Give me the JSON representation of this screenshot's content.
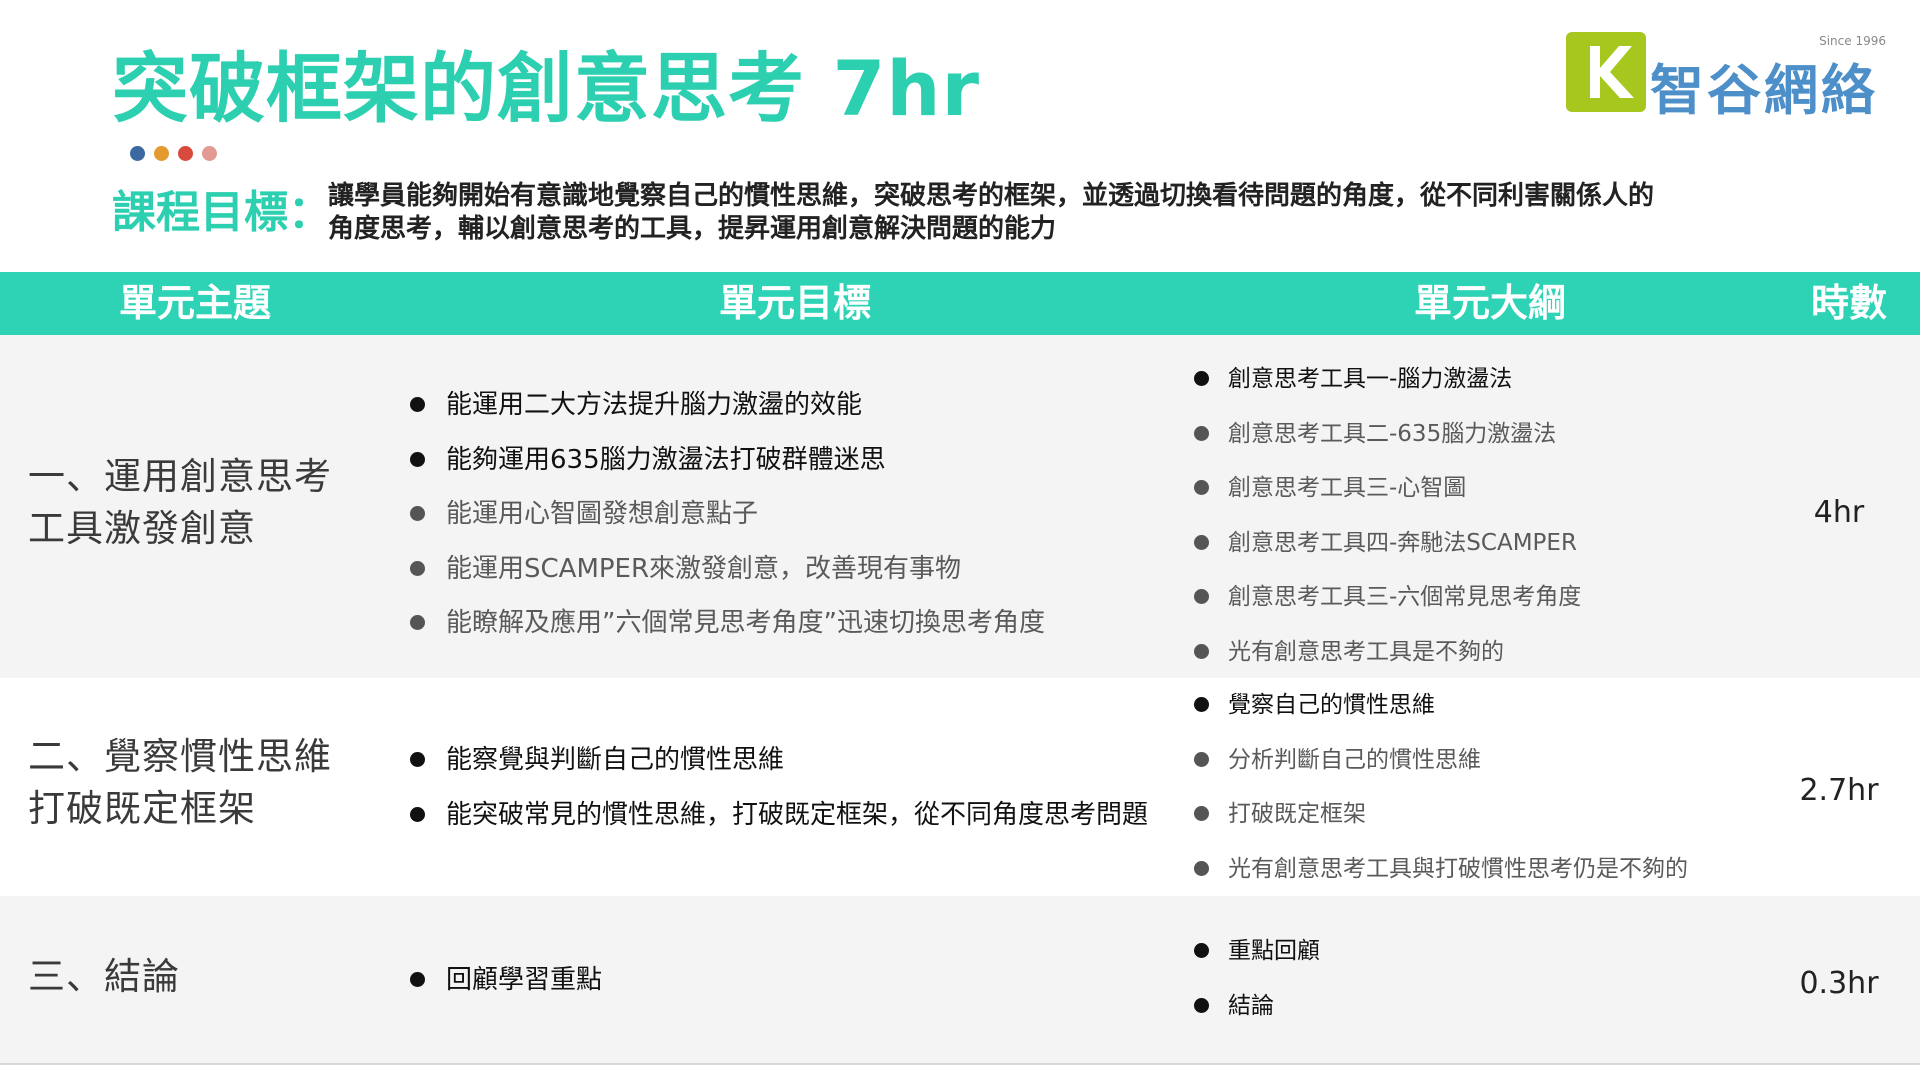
{
  "slide": {
    "title": "突破框架的創意思考 7hr",
    "goal_label": "課程目標：",
    "goal_text": "讓學員能夠開始有意識地覺察自己的慣性思維，突破思考的框架，並透過切換看待問題的角度，從不同利害關係人的角度思考，輔以創意思考的工具，提昇運用創意解決問題的能力",
    "dot_colors": [
      "#3b6aa0",
      "#e39a2e",
      "#d84a3c",
      "#e29a92"
    ]
  },
  "logo": {
    "text": "智谷網絡",
    "since": "Since 1996",
    "mark_color": "#a6c81e",
    "text_color": "#4d8fc8"
  },
  "table": {
    "headers": [
      "單元主題",
      "單元目標",
      "單元大綱",
      "時數"
    ],
    "header_color": "#2ed3b6",
    "rows": [
      {
        "topic": "一、運用創意思考工具激發創意",
        "goals": [
          "能運用二大方法提升腦力激盪的效能",
          "能夠運用635腦力激盪法打破群體迷思",
          "能運用心智圖發想創意點子",
          "能運用SCAMPER來激發創意，改善現有事物",
          "能瞭解及應用”六個常見思考角度”迅速切換思考角度"
        ],
        "outline": [
          "創意思考工具一-腦力激盪法",
          "創意思考工具二-635腦力激盪法",
          "創意思考工具三-心智圖",
          "創意思考工具四-奔馳法SCAMPER",
          "創意思考工具三-六個常見思考角度",
          "光有創意思考工具是不夠的"
        ],
        "hours": "4hr"
      },
      {
        "topic": "二、覺察慣性思維打破既定框架",
        "goals": [
          "能察覺與判斷自己的慣性思維",
          "能突破常見的慣性思維，打破既定框架，從不同角度思考問題"
        ],
        "outline": [
          "覺察自己的慣性思維",
          "分析判斷自己的慣性思維",
          "打破既定框架",
          "光有創意思考工具與打破慣性思考仍是不夠的"
        ],
        "hours": "2.7hr"
      },
      {
        "topic": "三、結論",
        "goals": [
          "回顧學習重點"
        ],
        "outline": [
          "重點回顧",
          "結論"
        ],
        "hours": "0.3hr"
      }
    ]
  }
}
